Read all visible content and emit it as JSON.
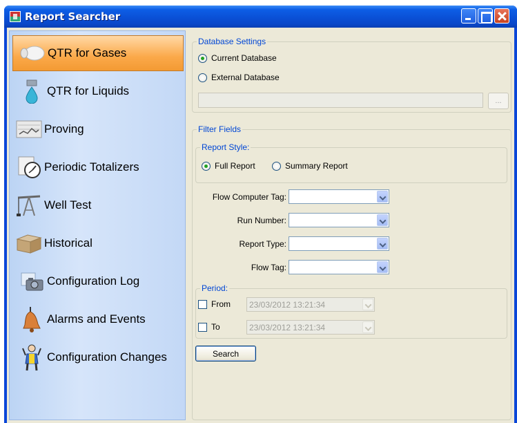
{
  "window": {
    "title": "Report Searcher"
  },
  "sidebar": {
    "items": [
      {
        "label": "QTR for Gases",
        "icon": "gas-cylinder-icon",
        "selected": true
      },
      {
        "label": "QTR for Liquids",
        "icon": "liquid-drop-icon",
        "selected": false
      },
      {
        "label": "Proving",
        "icon": "proving-chart-icon",
        "selected": false
      },
      {
        "label": "Periodic Totalizers",
        "icon": "stopwatch-icon",
        "selected": false
      },
      {
        "label": "Well Test",
        "icon": "oil-pumpjack-icon",
        "selected": false
      },
      {
        "label": "Historical",
        "icon": "archive-box-icon",
        "selected": false
      },
      {
        "label": "Configuration Log",
        "icon": "camera-icon",
        "selected": false
      },
      {
        "label": "Alarms and Events",
        "icon": "alarm-bell-icon",
        "selected": false
      },
      {
        "label": "Configuration Changes",
        "icon": "worker-icon",
        "selected": false
      }
    ]
  },
  "database_settings": {
    "legend": "Database Settings",
    "current_label": "Current Database",
    "external_label": "External Database",
    "selected": "Current Database",
    "path_value": "",
    "browse_label": "..."
  },
  "filter_fields": {
    "legend": "Filter Fields",
    "report_style": {
      "legend": "Report Style:",
      "full_label": "Full Report",
      "summary_label": "Summary Report",
      "selected": "Full Report"
    },
    "flow_computer_tag_label": "Flow Computer Tag:",
    "run_number_label": "Run Number:",
    "report_type_label": "Report Type:",
    "flow_tag_label": "Flow Tag:",
    "period": {
      "legend": "Period:",
      "from_label": "From",
      "to_label": "To",
      "from_value": "23/03/2012 13:21:34",
      "to_value": "23/03/2012 13:21:34"
    },
    "search_label": "Search"
  }
}
